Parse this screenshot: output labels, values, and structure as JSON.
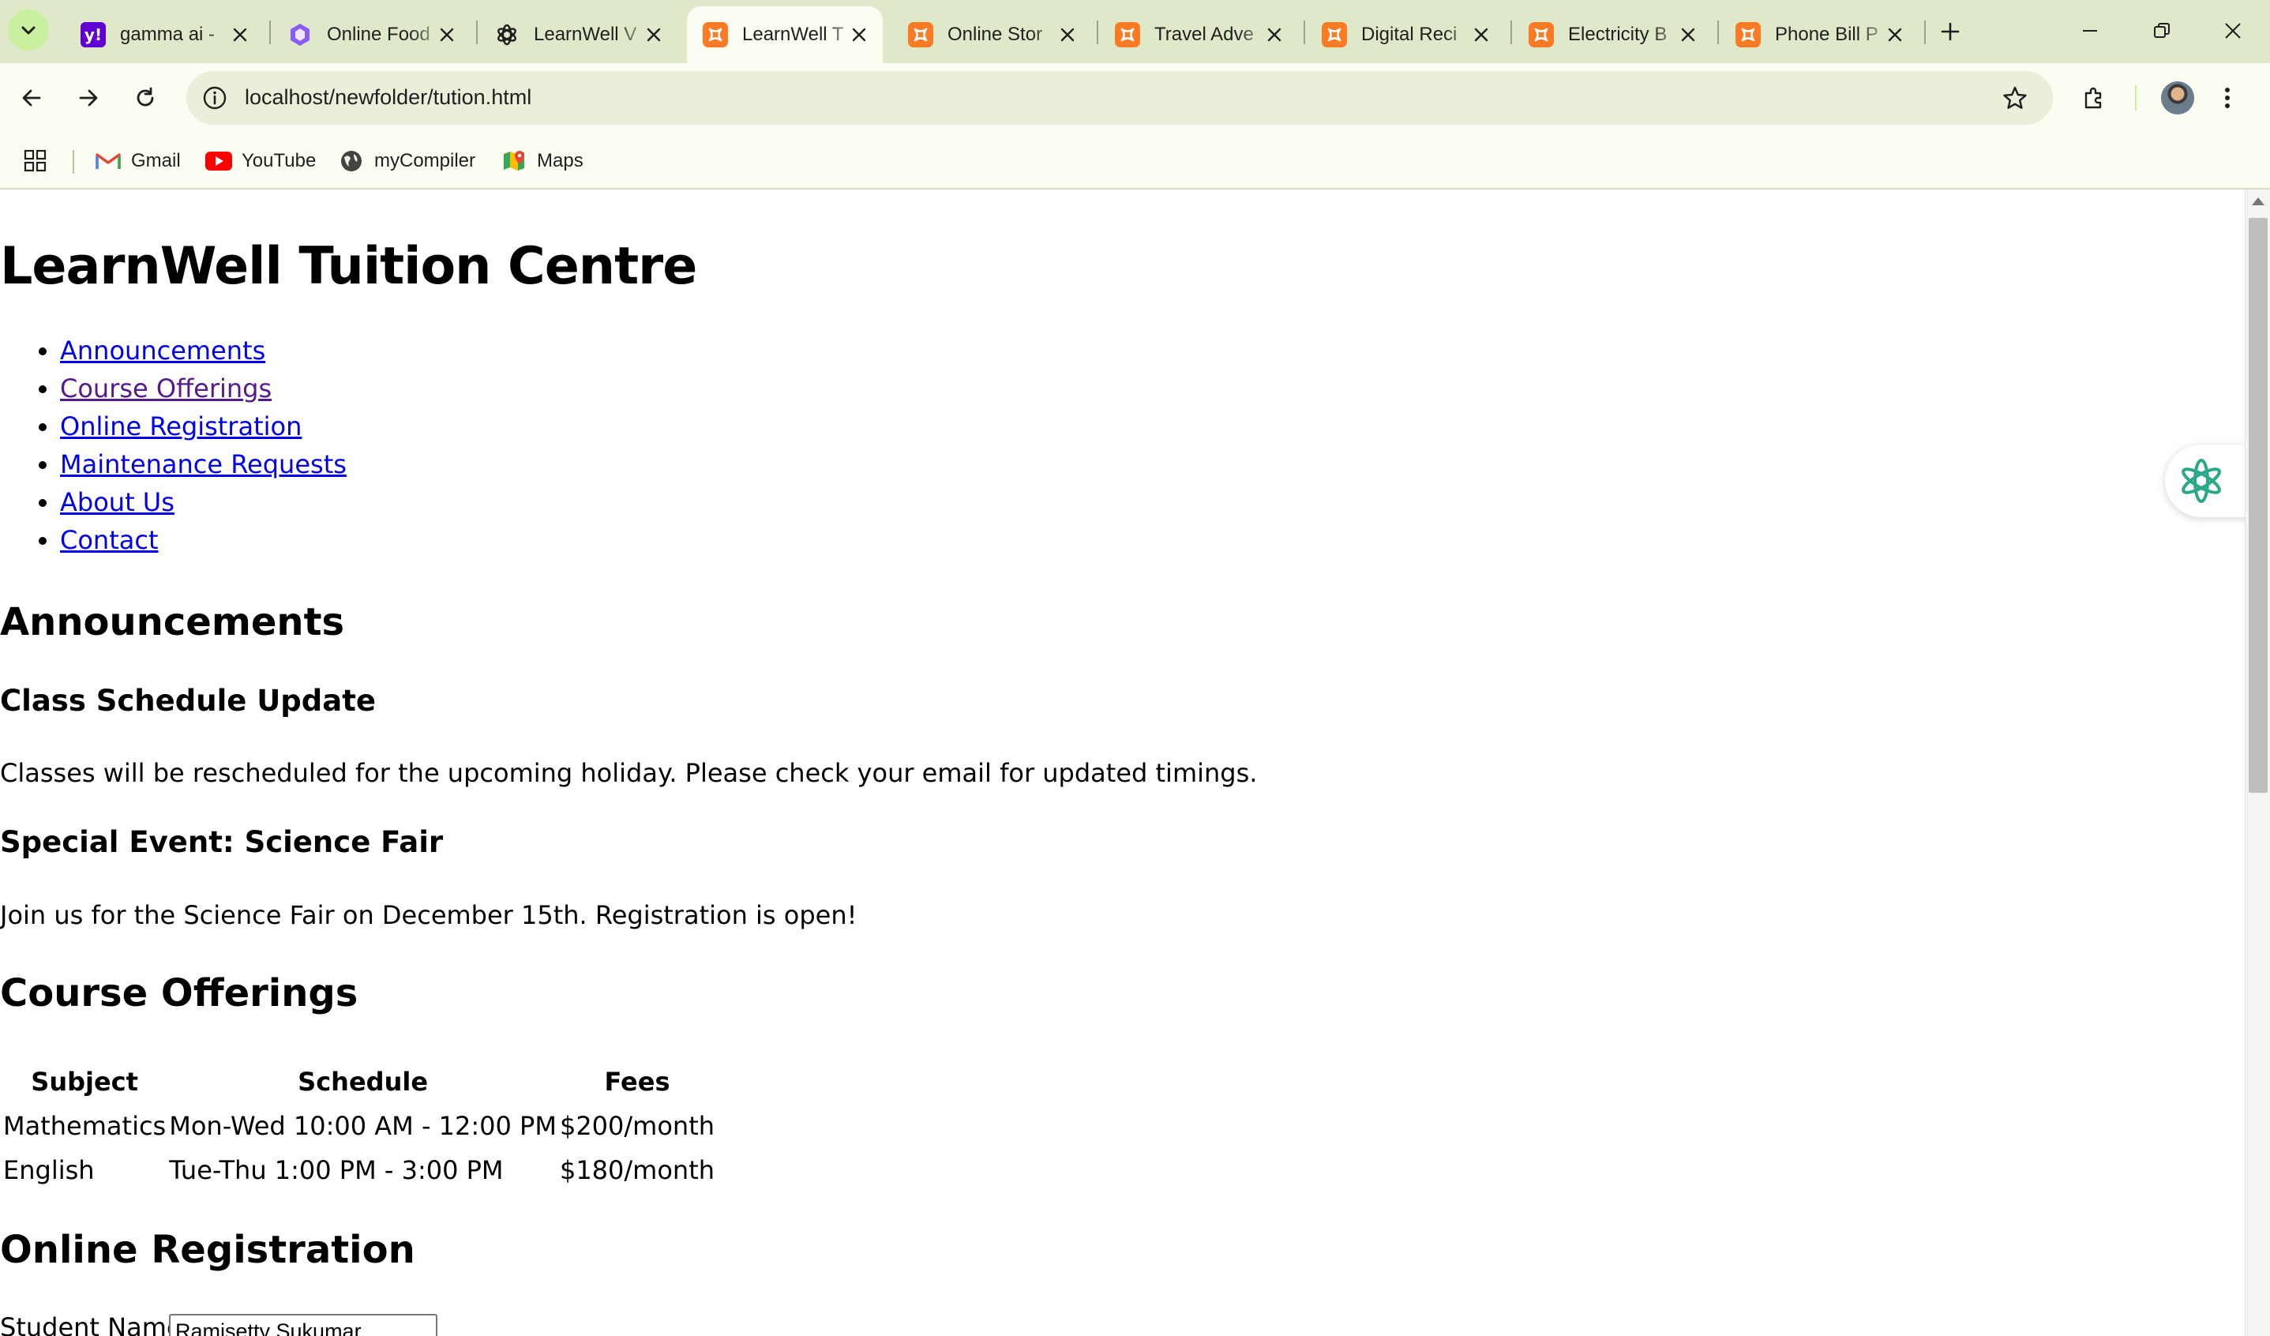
{
  "browser": {
    "tabs": [
      {
        "title": "gamma ai -",
        "icon": "yahoo-icon",
        "active": false
      },
      {
        "title": "Online Food",
        "icon": "gamma-icon",
        "active": false
      },
      {
        "title": "LearnWell V",
        "icon": "chatgpt-icon",
        "active": false
      },
      {
        "title": "LearnWell T",
        "icon": "xampp-icon",
        "active": true
      },
      {
        "title": "Online Stor",
        "icon": "xampp-icon",
        "active": false
      },
      {
        "title": "Travel Adve",
        "icon": "xampp-icon",
        "active": false
      },
      {
        "title": "Digital Reci",
        "icon": "xampp-icon",
        "active": false
      },
      {
        "title": "Electricity B",
        "icon": "xampp-icon",
        "active": false
      },
      {
        "title": "Phone Bill P",
        "icon": "xampp-icon",
        "active": false
      }
    ],
    "url": "localhost/newfolder/tution.html",
    "bookmarks": [
      {
        "label": "Gmail",
        "icon": "gmail-icon"
      },
      {
        "label": "YouTube",
        "icon": "youtube-icon"
      },
      {
        "label": "myCompiler",
        "icon": "globe-icon"
      },
      {
        "label": "Maps",
        "icon": "maps-icon"
      }
    ],
    "colors": {
      "frame": "#dfe8c8",
      "toolbar": "#fbfdf2",
      "omnibox": "#e9efd9",
      "accent": "#c8f0a0"
    }
  },
  "page": {
    "title": "LearnWell Tuition Centre",
    "nav": [
      {
        "label": "Announcements",
        "visited": false
      },
      {
        "label": "Course Offerings",
        "visited": true
      },
      {
        "label": "Online Registration",
        "visited": false
      },
      {
        "label": "Maintenance Requests",
        "visited": false
      },
      {
        "label": "About Us",
        "visited": false
      },
      {
        "label": "Contact",
        "visited": false
      }
    ],
    "announcements": {
      "heading": "Announcements",
      "items": [
        {
          "title": "Class Schedule Update",
          "text": "Classes will be rescheduled for the upcoming holiday. Please check your email for updated timings."
        },
        {
          "title": "Special Event: Science Fair",
          "text": "Join us for the Science Fair on December 15th. Registration is open!"
        }
      ]
    },
    "courses": {
      "heading": "Course Offerings",
      "columns": [
        "Subject",
        "Schedule",
        "Fees"
      ],
      "rows": [
        [
          "Mathematics",
          "Mon-Wed 10:00 AM - 12:00 PM",
          "$200/month"
        ],
        [
          "English",
          "Tue-Thu 1:00 PM - 3:00 PM",
          "$180/month"
        ]
      ]
    },
    "registration": {
      "heading": "Online Registration",
      "student_label": "Student Name:",
      "student_value": "Ramisetty Sukumar"
    }
  }
}
